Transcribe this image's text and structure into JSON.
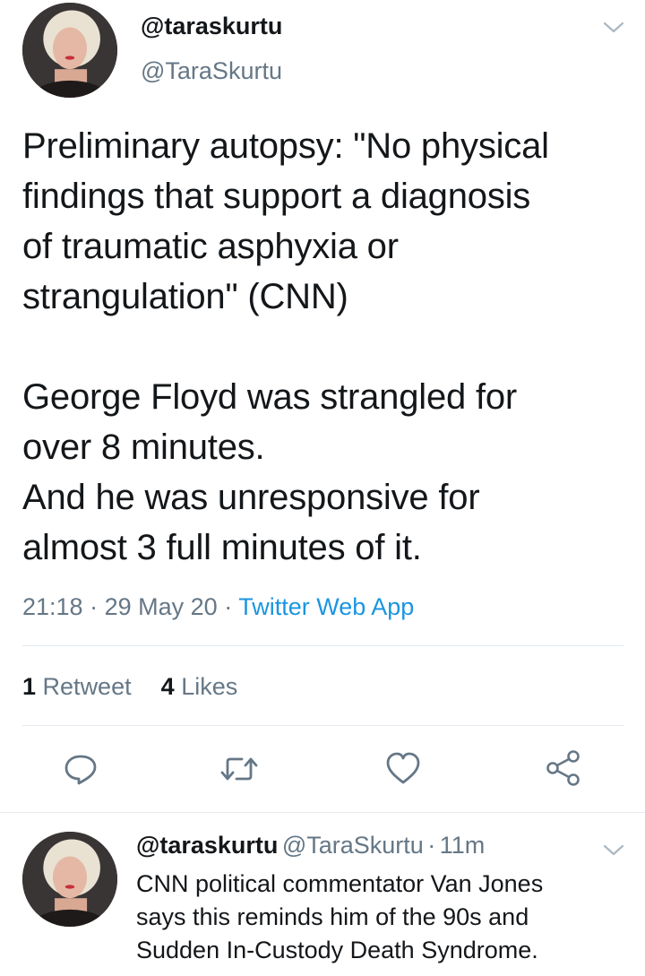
{
  "tweet": {
    "display_name": "@taraskurtu",
    "handle": "@TaraSkurtu",
    "text": "Preliminary autopsy: \"No physical\nfindings that support a diagnosis\nof traumatic asphyxia or\nstrangulation\" (CNN)\n\nGeorge Floyd was strangled for\nover 8 minutes.\nAnd he was unresponsive for\nalmost 3 full minutes of it.",
    "time": "21:18",
    "date": "29 May 20",
    "source": "Twitter Web App",
    "separator": "·",
    "retweets_count": "1",
    "retweets_label": "Retweet",
    "likes_count": "4",
    "likes_label": "Likes",
    "menu_icon": "chevron-down-icon"
  },
  "actions": [
    {
      "name": "reply",
      "icon": "reply-icon"
    },
    {
      "name": "retweet",
      "icon": "retweet-icon"
    },
    {
      "name": "like",
      "icon": "heart-icon"
    },
    {
      "name": "share",
      "icon": "share-icon"
    }
  ],
  "reply": {
    "display_name": "@taraskurtu",
    "handle": "@TaraSkurtu",
    "separator": "·",
    "time_ago": "11m",
    "text": "CNN political commentator Van Jones\nsays this reminds him of the 90s and\nSudden In-Custody Death Syndrome."
  },
  "colors": {
    "text": "#14171a",
    "secondary": "#657786",
    "link": "#1b95e0",
    "divider": "#e1e8ed",
    "icon": "#657786"
  }
}
